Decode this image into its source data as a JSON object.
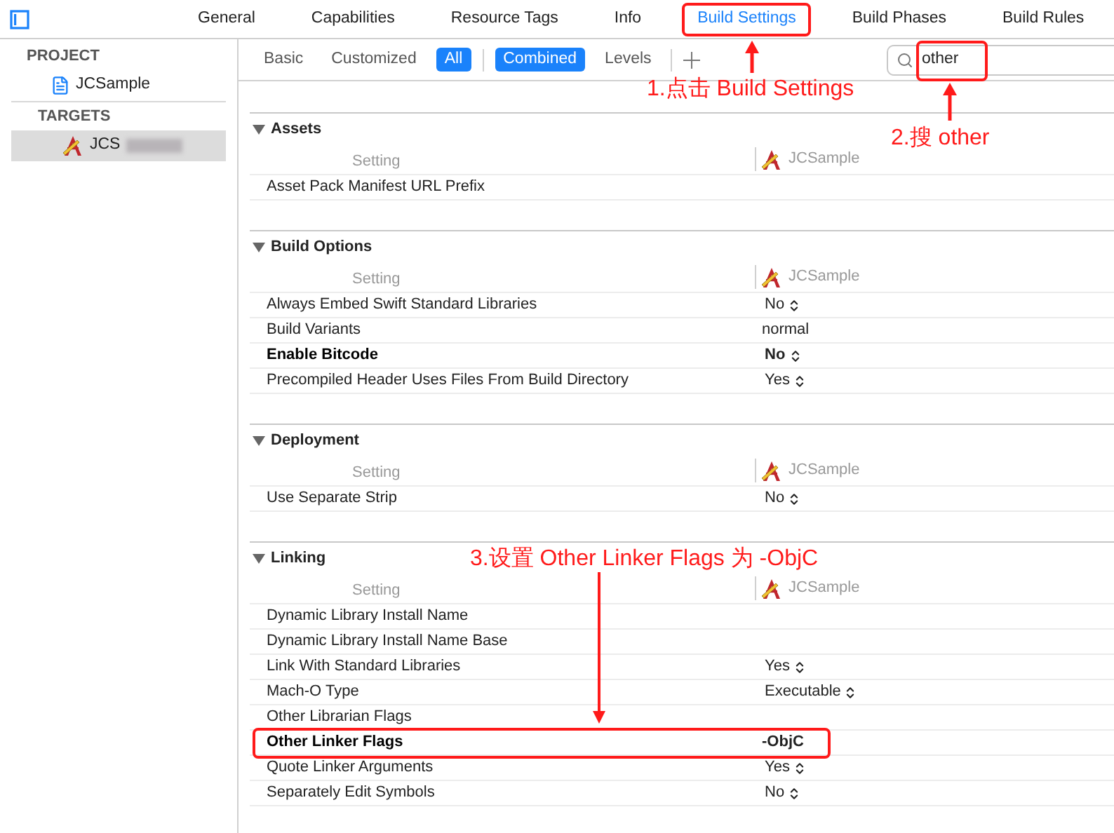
{
  "tabs": [
    {
      "label": "General",
      "selected": false,
      "highlighted": false
    },
    {
      "label": "Capabilities",
      "selected": false,
      "highlighted": false
    },
    {
      "label": "Resource Tags",
      "selected": false,
      "highlighted": false
    },
    {
      "label": "Info",
      "selected": false,
      "highlighted": false
    },
    {
      "label": "Build Settings",
      "selected": true,
      "highlighted": true
    },
    {
      "label": "Build Phases",
      "selected": false,
      "highlighted": false
    },
    {
      "label": "Build Rules",
      "selected": false,
      "highlighted": false
    }
  ],
  "sidebar": [
    {
      "heading": "PROJECT",
      "items": [
        {
          "label": "JCSample",
          "kind": "project",
          "selected": false,
          "redacted": false
        }
      ]
    },
    {
      "heading": "TARGETS",
      "items": [
        {
          "label": "JCS",
          "kind": "target",
          "selected": true,
          "redacted": true
        }
      ]
    }
  ],
  "filters": [
    [
      {
        "label": "Basic",
        "selected": false
      },
      {
        "label": "Customized",
        "selected": false
      },
      {
        "label": "All",
        "selected": true
      }
    ],
    [
      {
        "label": "Combined",
        "selected": true
      },
      {
        "label": "Levels",
        "selected": false
      }
    ]
  ],
  "search": {
    "value": "other",
    "highlighted": true
  },
  "sections": [
    {
      "title": "Assets",
      "expanded": true,
      "setting_header": "Setting",
      "target_header": "JCSample",
      "rows": [
        {
          "name": "Asset Pack Manifest URL Prefix",
          "value": null,
          "kind": "text",
          "bold": false,
          "highlighted": false
        }
      ]
    },
    {
      "title": "Build Options",
      "expanded": true,
      "setting_header": "Setting",
      "target_header": "JCSample",
      "rows": [
        {
          "name": "Always Embed Swift Standard Libraries",
          "value": "No",
          "kind": "popup",
          "bold": false,
          "highlighted": false
        },
        {
          "name": "Build Variants",
          "value": "normal",
          "kind": "text",
          "bold": false,
          "highlighted": false
        },
        {
          "name": "Enable Bitcode",
          "value": "No",
          "kind": "popup",
          "bold": true,
          "highlighted": false
        },
        {
          "name": "Precompiled Header Uses Files From Build Directory",
          "value": "Yes",
          "kind": "popup",
          "bold": false,
          "highlighted": false
        }
      ]
    },
    {
      "title": "Deployment",
      "expanded": true,
      "setting_header": "Setting",
      "target_header": "JCSample",
      "rows": [
        {
          "name": "Use Separate Strip",
          "value": "No",
          "kind": "popup",
          "bold": false,
          "highlighted": false
        }
      ]
    },
    {
      "title": "Linking",
      "expanded": true,
      "setting_header": "Setting",
      "target_header": "JCSample",
      "rows": [
        {
          "name": "Dynamic Library Install Name",
          "value": null,
          "kind": "text",
          "bold": false,
          "highlighted": false
        },
        {
          "name": "Dynamic Library Install Name Base",
          "value": null,
          "kind": "text",
          "bold": false,
          "highlighted": false
        },
        {
          "name": "Link With Standard Libraries",
          "value": "Yes",
          "kind": "popup",
          "bold": false,
          "highlighted": false
        },
        {
          "name": "Mach-O Type",
          "value": "Executable",
          "kind": "popup",
          "bold": false,
          "highlighted": false
        },
        {
          "name": "Other Librarian Flags",
          "value": null,
          "kind": "text",
          "bold": false,
          "highlighted": false
        },
        {
          "name": "Other Linker Flags",
          "value": "-ObjC",
          "kind": "text",
          "bold": true,
          "highlighted": true
        },
        {
          "name": "Quote Linker Arguments",
          "value": "Yes",
          "kind": "popup",
          "bold": false,
          "highlighted": false
        },
        {
          "name": "Separately Edit Symbols",
          "value": "No",
          "kind": "popup",
          "bold": false,
          "highlighted": false
        }
      ]
    }
  ],
  "annotations": [
    "1.点击 Build Settings",
    "2.搜 other",
    "3.设置 Other Linker Flags 为 -ObjC"
  ]
}
